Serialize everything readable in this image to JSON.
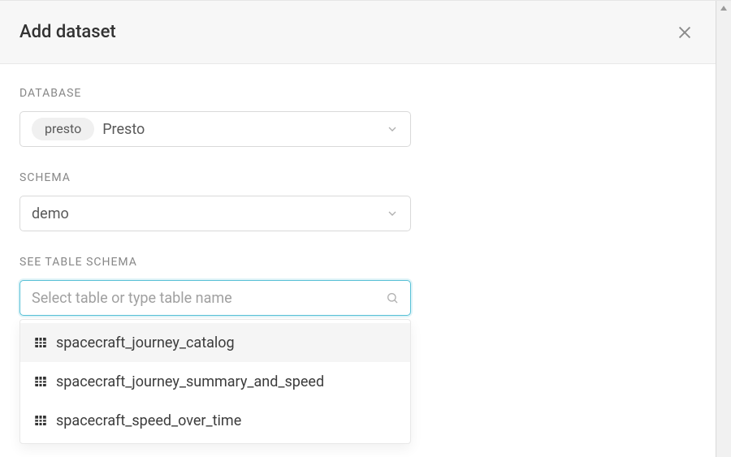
{
  "header": {
    "title": "Add dataset"
  },
  "fields": {
    "database": {
      "label": "DATABASE",
      "engine_badge": "presto",
      "value": "Presto"
    },
    "schema": {
      "label": "SCHEMA",
      "value": "demo"
    },
    "table": {
      "label": "SEE TABLE SCHEMA",
      "placeholder": "Select table or type table name",
      "options": [
        "spacecraft_journey_catalog",
        "spacecraft_journey_summary_and_speed",
        "spacecraft_speed_over_time"
      ]
    }
  }
}
